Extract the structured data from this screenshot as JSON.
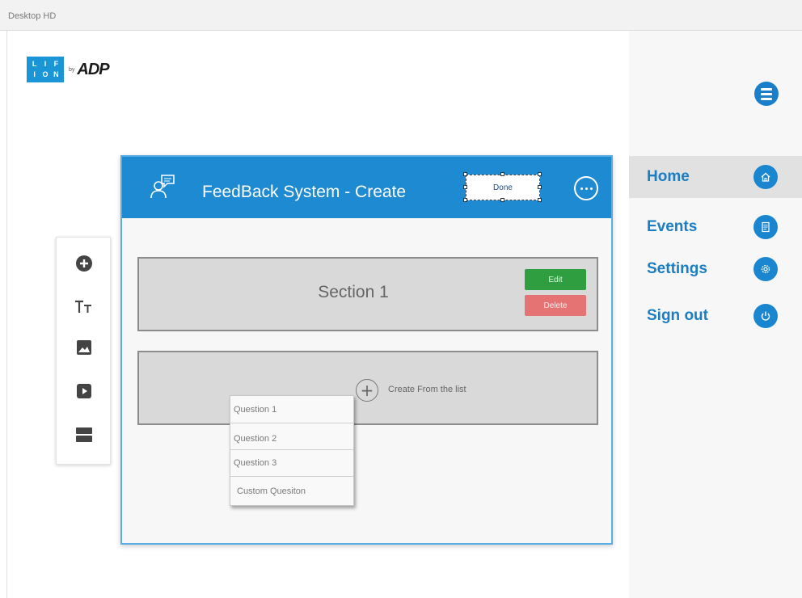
{
  "window": {
    "title": "Desktop HD"
  },
  "logo": {
    "letters": [
      "L",
      "I",
      "F",
      "I",
      "O",
      "N"
    ],
    "by": "by",
    "brand": "ADP"
  },
  "card": {
    "title": "FeedBack System - Create",
    "done_label": "Done",
    "section": {
      "title": "Section 1",
      "edit_label": "Edit",
      "delete_label": "Delete"
    },
    "create": {
      "label": "Create From the list"
    }
  },
  "dropdown": {
    "items": [
      "Question 1",
      "Question 2",
      "Question 3",
      "Custom Quesiton"
    ]
  },
  "nav": {
    "items": [
      {
        "label": "Home",
        "icon": "home-icon",
        "active": true
      },
      {
        "label": "Events",
        "icon": "document-icon",
        "active": false
      },
      {
        "label": "Settings",
        "icon": "gear-icon",
        "active": false
      },
      {
        "label": "Sign out",
        "icon": "power-icon",
        "active": false
      }
    ]
  },
  "toolbar": {
    "tools": [
      "add-icon",
      "text-size-icon",
      "image-icon",
      "video-icon",
      "layout-icon"
    ]
  },
  "colors": {
    "header_blue": "#1d8ad2",
    "nav_blue": "#1b7dc2",
    "edit_green": "#2e9e41",
    "delete_red": "#e57373"
  }
}
